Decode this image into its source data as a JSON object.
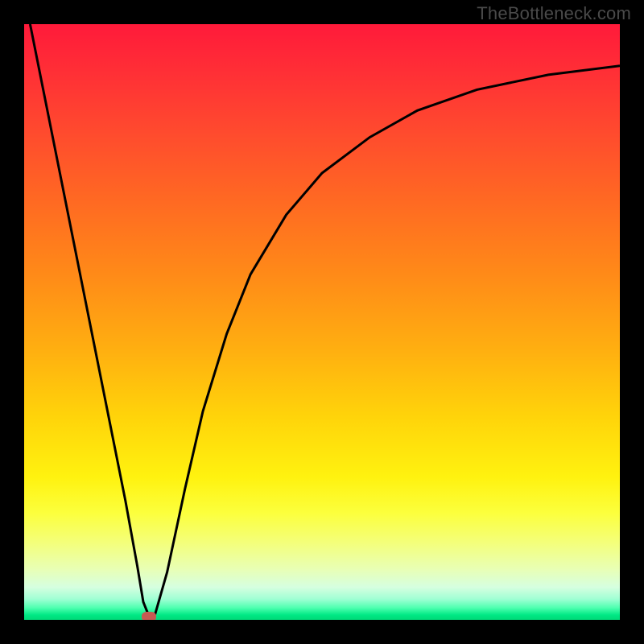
{
  "watermark": "TheBottleneck.com",
  "colors": {
    "frame_bg": "#000000",
    "curve_stroke": "#000000",
    "marker_fill": "#c65a52",
    "watermark_text": "#4a4a4a"
  },
  "chart_data": {
    "type": "line",
    "title": "",
    "xlabel": "",
    "ylabel": "",
    "xlim": [
      0,
      100
    ],
    "ylim": [
      0,
      100
    ],
    "grid": false,
    "legend": false,
    "series": [
      {
        "name": "curve",
        "x": [
          1,
          5,
          10,
          15,
          17,
          19,
          20,
          21,
          22,
          24,
          27,
          30,
          34,
          38,
          44,
          50,
          58,
          66,
          76,
          88,
          100
        ],
        "values": [
          100,
          80,
          55,
          30,
          20,
          9,
          3,
          0.5,
          1,
          8,
          22,
          35,
          48,
          58,
          68,
          75,
          81,
          85.5,
          89,
          91.5,
          93
        ]
      }
    ],
    "marker": {
      "x": 21,
      "y": 0.5
    },
    "background_gradient_stops": [
      {
        "pos": 0,
        "color": "#ff1a3a"
      },
      {
        "pos": 8,
        "color": "#ff2f36"
      },
      {
        "pos": 18,
        "color": "#ff4a2e"
      },
      {
        "pos": 30,
        "color": "#ff6a22"
      },
      {
        "pos": 42,
        "color": "#ff8a18"
      },
      {
        "pos": 55,
        "color": "#ffb010"
      },
      {
        "pos": 66,
        "color": "#ffd40a"
      },
      {
        "pos": 76,
        "color": "#fff20f"
      },
      {
        "pos": 82,
        "color": "#fcff3c"
      },
      {
        "pos": 87,
        "color": "#f4ff7a"
      },
      {
        "pos": 91.5,
        "color": "#e8ffb5"
      },
      {
        "pos": 94.5,
        "color": "#d6ffe0"
      },
      {
        "pos": 96.5,
        "color": "#a0ffd4"
      },
      {
        "pos": 98,
        "color": "#4cffaf"
      },
      {
        "pos": 99.2,
        "color": "#00e884"
      },
      {
        "pos": 100,
        "color": "#00d878"
      }
    ]
  }
}
